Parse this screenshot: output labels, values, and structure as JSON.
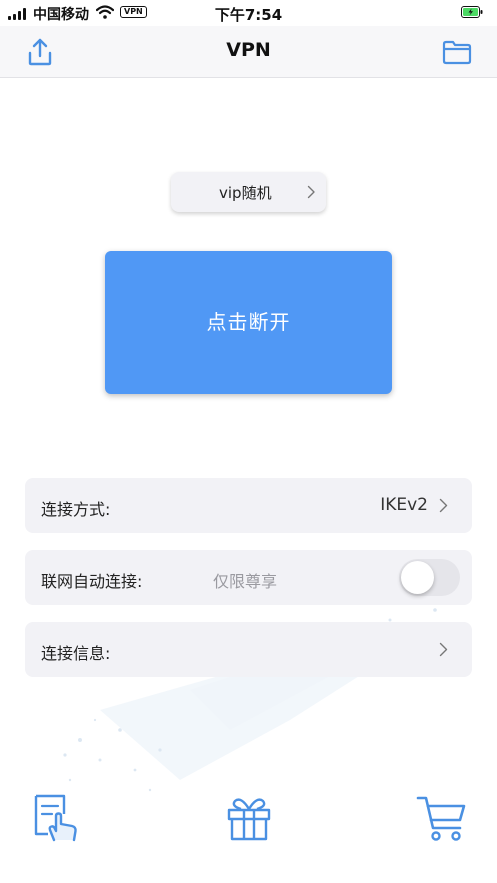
{
  "status_bar": {
    "carrier": "中国移动",
    "vpn_badge": "VPN",
    "time": "下午7:54"
  },
  "nav": {
    "title": "VPN",
    "left_icon": "share-upload-icon",
    "right_icon": "folder-icon"
  },
  "server": {
    "label": "vip随机"
  },
  "connect_button": {
    "label": "点击断开"
  },
  "settings": {
    "connection_mode": {
      "label": "连接方式:",
      "value": "IKEv2"
    },
    "auto_connect": {
      "label": "联网自动连接:",
      "hint": "仅限尊享",
      "enabled": false
    },
    "connection_info": {
      "label": "连接信息:"
    }
  },
  "bottom_icons": [
    "sign-in-touch-icon",
    "gift-icon",
    "cart-icon"
  ],
  "colors": {
    "accent": "#5098f5",
    "icon_blue": "#4a90e2",
    "row_bg": "#f2f2f6",
    "hint_text": "#9a9aa0"
  }
}
